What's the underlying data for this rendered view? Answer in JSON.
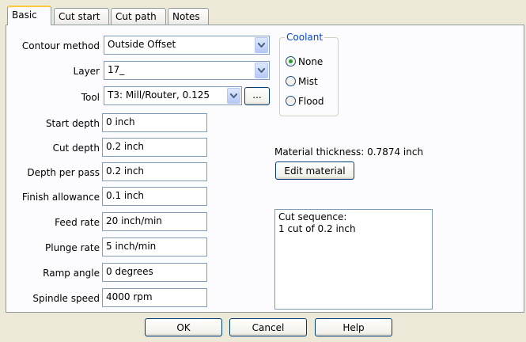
{
  "tabs": [
    "Basic",
    "Cut start",
    "Cut path",
    "Notes"
  ],
  "form": {
    "contour_method": {
      "label": "Contour method",
      "value": "Outside Offset"
    },
    "layer": {
      "label": "Layer",
      "value": "17_"
    },
    "tool": {
      "label": "Tool",
      "value": "T3: Mill/Router, 0.125",
      "browse": "..."
    },
    "start_depth": {
      "label": "Start depth",
      "value": "0 inch"
    },
    "cut_depth": {
      "label": "Cut depth",
      "value": "0.2 inch"
    },
    "depth_per_pass": {
      "label": "Depth per pass",
      "value": "0.2 inch"
    },
    "finish_allowance": {
      "label": "Finish allowance",
      "value": "0.1 inch"
    },
    "feed_rate": {
      "label": "Feed rate",
      "value": "20 inch/min"
    },
    "plunge_rate": {
      "label": "Plunge rate",
      "value": "5 inch/min"
    },
    "ramp_angle": {
      "label": "Ramp angle",
      "value": "0 degrees"
    },
    "spindle_speed": {
      "label": "Spindle speed",
      "value": "4000 rpm"
    }
  },
  "coolant": {
    "title": "Coolant",
    "options": [
      "None",
      "Mist",
      "Flood"
    ],
    "selected": "None"
  },
  "material": {
    "thickness": "Material thickness: 0.7874 inch",
    "edit_button": "Edit material"
  },
  "sequence": "Cut sequence:\n1 cut of 0.2 inch",
  "buttons": {
    "ok": "OK",
    "cancel": "Cancel",
    "help": "Help"
  },
  "colors": {
    "accent_tab": "#ffc83c",
    "group_title": "#0046d5",
    "radio_selected": "#21a121"
  }
}
